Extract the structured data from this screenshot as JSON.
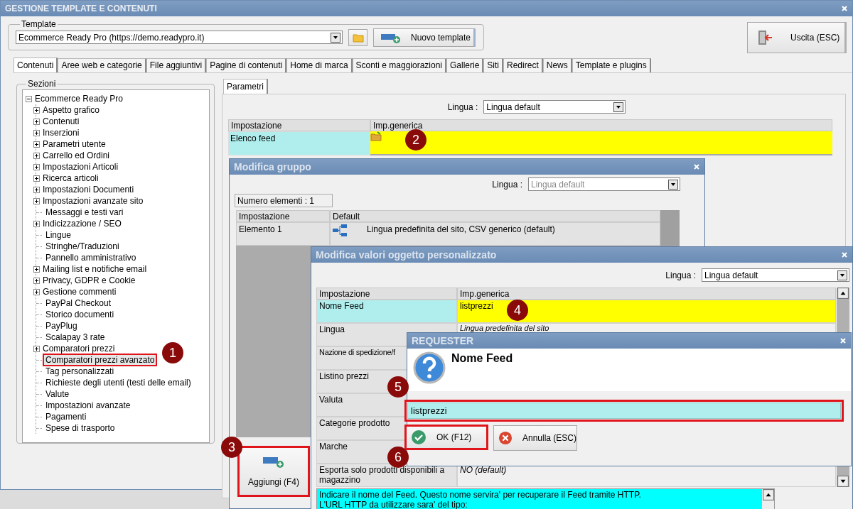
{
  "window": {
    "title": "GESTIONE TEMPLATE E CONTENUTI"
  },
  "template": {
    "label": "Template",
    "value": "Ecommerce Ready Pro (https://demo.readypro.it)",
    "new_button": "Nuovo template"
  },
  "exit_button": "Uscita (ESC)",
  "tabs": [
    {
      "label": "Contenuti",
      "selected": true
    },
    {
      "label": "Aree web e categorie",
      "selected": false
    },
    {
      "label": "File aggiuntivi",
      "selected": false
    },
    {
      "label": "Pagine di contenuti",
      "selected": false
    },
    {
      "label": "Home di marca",
      "selected": false
    },
    {
      "label": "Sconti e maggiorazioni",
      "selected": false
    },
    {
      "label": "Gallerie",
      "selected": false
    },
    {
      "label": "Siti",
      "selected": false
    },
    {
      "label": "Redirect",
      "selected": false
    },
    {
      "label": "News",
      "selected": false
    },
    {
      "label": "Template e plugins",
      "selected": false
    }
  ],
  "sections": {
    "label": "Sezioni",
    "root": {
      "label": "Ecommerce Ready Pro",
      "expanded": true,
      "children": [
        {
          "label": "Aspetto grafico",
          "kind": "folder",
          "selected": false
        },
        {
          "label": "Contenuti",
          "kind": "folder",
          "selected": false
        },
        {
          "label": "Inserzioni",
          "kind": "folder",
          "selected": false
        },
        {
          "label": "Parametri utente",
          "kind": "folder",
          "selected": false
        },
        {
          "label": "Carrello ed Ordini",
          "kind": "folder",
          "selected": false
        },
        {
          "label": "Impostazioni Articoli",
          "kind": "folder",
          "selected": false
        },
        {
          "label": "Ricerca articoli",
          "kind": "folder",
          "selected": false
        },
        {
          "label": "Impostazioni Documenti",
          "kind": "folder",
          "selected": false
        },
        {
          "label": "Impostazioni avanzate sito",
          "kind": "folder",
          "selected": false
        },
        {
          "label": "Messaggi e testi vari",
          "kind": "leaf",
          "selected": false
        },
        {
          "label": "Indicizzazione / SEO",
          "kind": "folder",
          "selected": false
        },
        {
          "label": "Lingue",
          "kind": "leaf",
          "selected": false
        },
        {
          "label": "Stringhe/Traduzioni",
          "kind": "leaf",
          "selected": false
        },
        {
          "label": "Pannello amministrativo",
          "kind": "leaf",
          "selected": false
        },
        {
          "label": "Mailing list e notifiche email",
          "kind": "folder",
          "selected": false
        },
        {
          "label": "Privacy, GDPR e Cookie",
          "kind": "folder",
          "selected": false
        },
        {
          "label": "Gestione commenti",
          "kind": "folder",
          "selected": false
        },
        {
          "label": "PayPal Checkout",
          "kind": "leaf",
          "selected": false
        },
        {
          "label": "Storico documenti",
          "kind": "leaf",
          "selected": false
        },
        {
          "label": "PayPlug",
          "kind": "leaf",
          "selected": false
        },
        {
          "label": "Scalapay 3 rate",
          "kind": "leaf",
          "selected": false
        },
        {
          "label": "Comparatori prezzi",
          "kind": "folder",
          "selected": false
        },
        {
          "label": "Comparatori prezzi avanzato",
          "kind": "leaf",
          "selected": true
        },
        {
          "label": "Tag personalizzati",
          "kind": "leaf",
          "selected": false
        },
        {
          "label": "Richieste degli utenti (testi delle email)",
          "kind": "leaf",
          "selected": false
        },
        {
          "label": "Valute",
          "kind": "leaf",
          "selected": false
        },
        {
          "label": "Impostazioni avanzate",
          "kind": "leaf",
          "selected": false
        },
        {
          "label": "Pagamenti",
          "kind": "leaf",
          "selected": false
        },
        {
          "label": "Spese di trasporto",
          "kind": "leaf",
          "selected": false
        }
      ]
    }
  },
  "parameters": {
    "tab": "Parametri",
    "language_label": "Lingua :",
    "language": "Lingua default",
    "columns": [
      "Impostazione",
      "Imp.generica"
    ],
    "rows": [
      {
        "name": "Elenco feed",
        "selected": true
      }
    ]
  },
  "group_dialog": {
    "title": "Modifica gruppo",
    "language_label": "Lingua :",
    "language": "Lingua default",
    "language_disabled": true,
    "count": "Numero elementi : 1",
    "columns": [
      "Impostazione",
      "Default"
    ],
    "rows": [
      {
        "name": "Elemento 1",
        "value": "Lingua predefinita del sito, CSV generico (default)"
      }
    ],
    "add_button": "Aggiungi (F4)"
  },
  "object_dialog": {
    "title": "Modifica valori oggetto personalizzato",
    "language_label": "Lingua :",
    "language": "Lingua default",
    "columns": [
      "Impostazione",
      "Imp.generica"
    ],
    "rows": [
      {
        "name": "Nome Feed",
        "value": "listprezzi",
        "selected": true,
        "is_default": false
      },
      {
        "name": "Lingua",
        "value": "Lingua predefinita del sito",
        "selected": false,
        "is_default": true
      },
      {
        "name": "Nazione di spedizione/f",
        "selected": false
      },
      {
        "name": "Listino prezzi",
        "selected": false
      },
      {
        "name": "Valuta",
        "selected": false
      },
      {
        "name": "Categorie prodotto",
        "selected": false
      },
      {
        "name": "Marche",
        "selected": false
      },
      {
        "name": "Esporta solo prodotti disponibili a magazzino",
        "value": "NO (default)",
        "selected": false,
        "is_default": true
      }
    ],
    "help": [
      "Indicare il nome del Feed. Questo nome servira' per recuperare il Feed tramite HTTP.",
      "L'URL HTTP da utilizzare sara' del tipo:"
    ]
  },
  "requester": {
    "title": "REQUESTER",
    "heading": "Nome Feed",
    "value": "listprezzi",
    "ok_button": "OK (F12)",
    "cancel_button": "Annulla (ESC)"
  },
  "callouts": [
    "1",
    "2",
    "3",
    "4",
    "5",
    "6"
  ]
}
